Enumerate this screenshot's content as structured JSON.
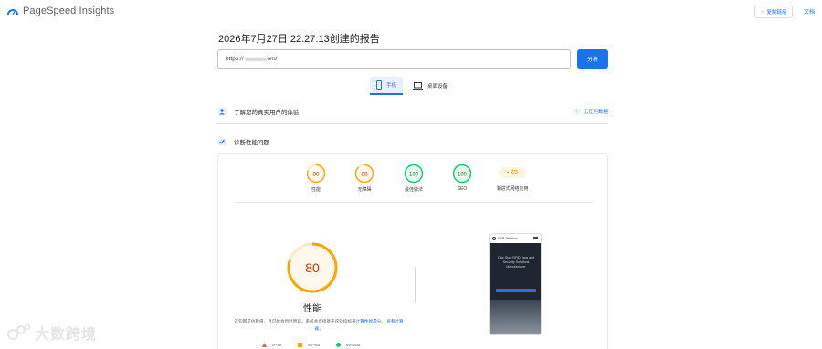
{
  "app": {
    "name": "PageSpeed Insights",
    "copy_link_label": "复制链接",
    "docs_label": "文档"
  },
  "report": {
    "title": "2026年7月27日 22:27:13创建的报告",
    "url_prefix": "https://",
    "url_suffix": "om/",
    "analyze_label": "分析"
  },
  "device_tabs": [
    {
      "label": "手机",
      "icon": "smartphone-icon",
      "active": true
    },
    {
      "label": "桌面设备",
      "icon": "laptop-icon",
      "active": false
    }
  ],
  "field_section": {
    "title": "了解您的真实用户的体验",
    "status": "无任何数据"
  },
  "diagnose_section": {
    "title": "诊断性能问题"
  },
  "scores": [
    {
      "label": "性能",
      "value": "80",
      "band": "average"
    },
    {
      "label": "无障碍",
      "value": "88",
      "band": "average"
    },
    {
      "label": "最佳做法",
      "value": "100",
      "band": "good"
    },
    {
      "label": "SEO",
      "value": "100",
      "band": "good"
    }
  ],
  "pwa": {
    "label": "渐进式网络应用",
    "value": "2/3"
  },
  "performance": {
    "score": "80",
    "fraction": 0.8,
    "label": "性能",
    "desc_part1": "这些都是估算值，且可能会因时而异。系统会直接基于这些指标来",
    "desc_link1": "计算性能得分",
    "desc_part2": "。",
    "desc_link2": "查看计算器。"
  },
  "legend": [
    {
      "range": "0–49",
      "shape": "triangle",
      "color": "#ff4e42"
    },
    {
      "range": "50–89",
      "shape": "square",
      "color": "#ffa400"
    },
    {
      "range": "90–100",
      "shape": "circle",
      "color": "#0cce6b"
    }
  ],
  "screenshot": {
    "brand": "RFID Solutions",
    "headline": "One-Stop RFID Tags and Security Solutions Manufacturer"
  },
  "watermark": "大数跨境",
  "colors": {
    "accent": "#1a73e8",
    "average": "#ffa400",
    "good": "#0cce6b",
    "poor": "#ff4e42"
  }
}
